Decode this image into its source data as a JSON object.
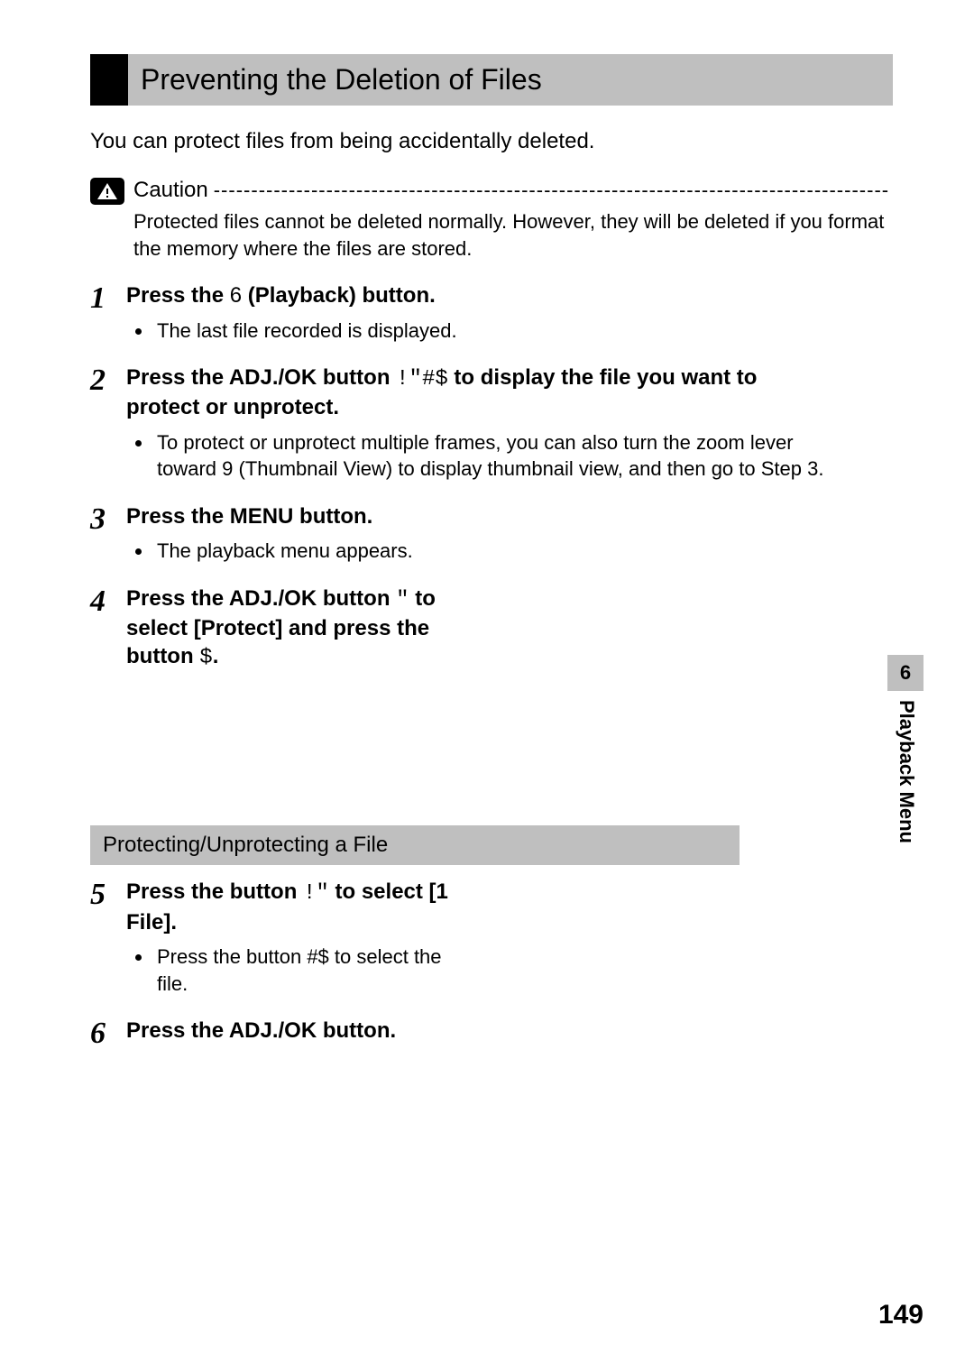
{
  "section_title": "Preventing the Deletion of Files",
  "intro": "You can protect files from being accidentally deleted.",
  "caution": {
    "label": "Caution",
    "dashes": "------------------------------------------------------------------------------------------",
    "body": "Protected files cannot be deleted normally. However, they will be deleted if you format the memory where the files are stored."
  },
  "steps": [
    {
      "num": "1",
      "title_parts": [
        "Press the ",
        "6",
        " (Playback) button."
      ],
      "bullets": [
        "The last file recorded is displayed."
      ]
    },
    {
      "num": "2",
      "title_parts": [
        "Press the ADJ./OK button ",
        "!\"#$",
        " to display the file you want to protect or unprotect."
      ],
      "bullets": [
        "To protect or unprotect multiple frames, you can also turn the zoom lever toward 9 (Thumbnail View) to display thumbnail view, and then go to Step 3."
      ]
    },
    {
      "num": "3",
      "title_parts": [
        "Press the MENU button."
      ],
      "bullets": [
        "The playback menu appears."
      ]
    },
    {
      "num": "4",
      "title_parts": [
        "Press the ADJ./OK button ",
        "\"",
        " to select [Protect] and press the button ",
        "$",
        "."
      ],
      "bullets": []
    }
  ],
  "subheader": "Protecting/Unprotecting a File",
  "steps2": [
    {
      "num": "5",
      "title_parts": [
        "Press the button ",
        "!\"",
        " to select [1 File]."
      ],
      "bullets": [
        "Press the button #$ to select the file."
      ]
    },
    {
      "num": "6",
      "title_parts": [
        "Press the ADJ./OK button."
      ],
      "bullets": []
    }
  ],
  "side_tab": {
    "num": "6",
    "label": "Playback Menu"
  },
  "page_number": "149"
}
